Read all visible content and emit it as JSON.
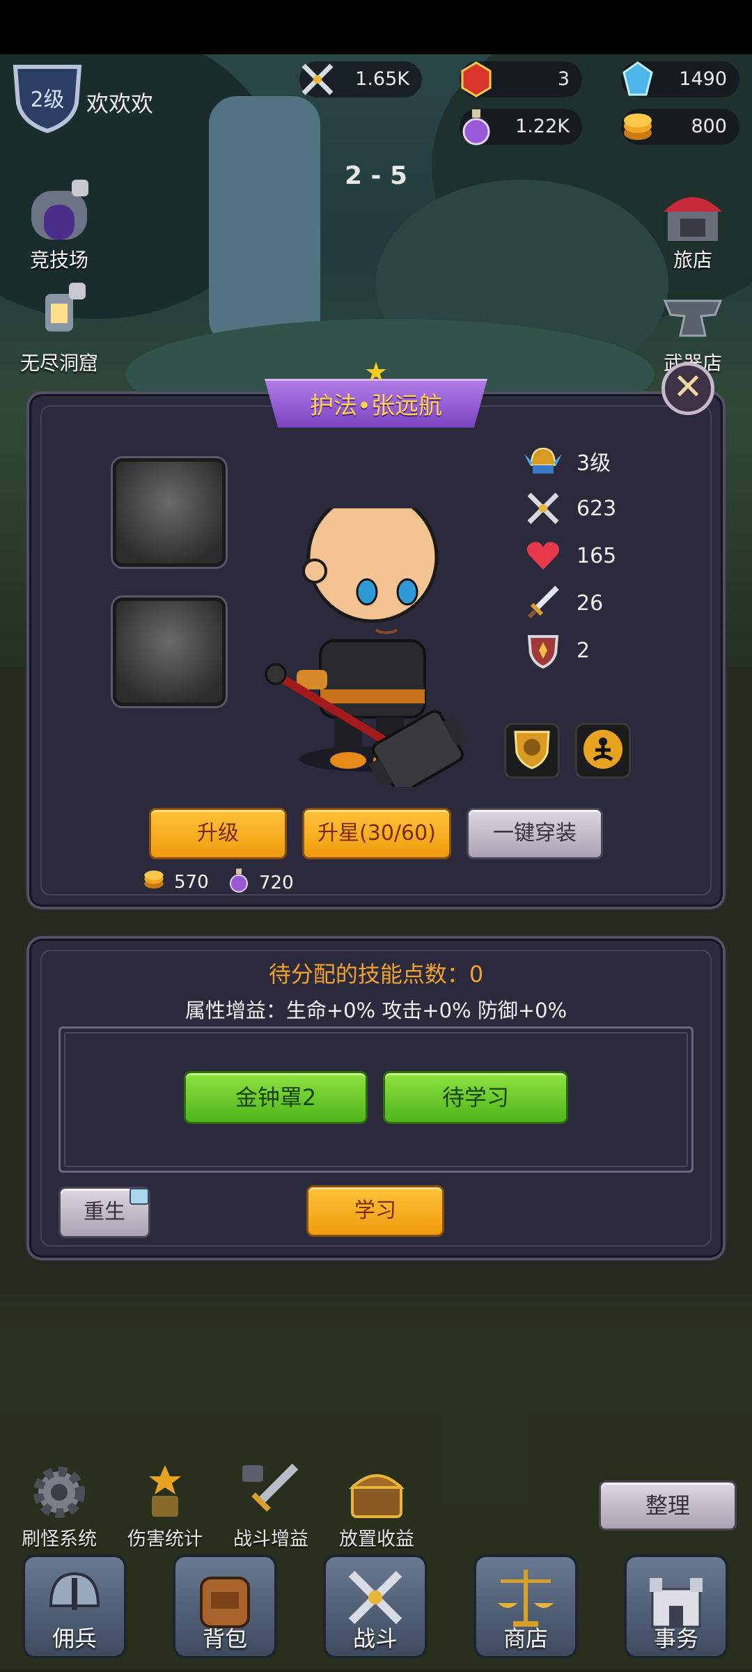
{
  "hud": {
    "level": "2级",
    "player_name": "欢欢欢",
    "power": "1.65K",
    "gems_red": "3",
    "gems_blue": "1490",
    "potion": "1.22K",
    "coins": "800",
    "stage": "2 - 5"
  },
  "side_left": [
    {
      "label": "竞技场",
      "icon": "arena-gate-icon"
    },
    {
      "label": "无尽洞窟",
      "icon": "cave-lantern-icon"
    }
  ],
  "side_right": [
    {
      "label": "旅店",
      "icon": "inn-icon"
    },
    {
      "label": "武器店",
      "icon": "anvil-icon"
    }
  ],
  "hero_panel": {
    "title": "护法•张远航",
    "stars": 1,
    "stats": {
      "level": "3级",
      "power": "623",
      "hp": "165",
      "attack": "26",
      "defense": "2"
    },
    "buttons": {
      "upgrade": "升级",
      "star_up": "升星(30/60)",
      "equip_all": "一键穿装"
    },
    "costs": {
      "coins": "570",
      "potion": "720"
    }
  },
  "skill_panel": {
    "points_label": "待分配的技能点数：0",
    "bonus_label": "属性增益：生命+0% 攻击+0% 防御+0%",
    "skills": [
      "金钟罩2",
      "待学习"
    ],
    "rebirth": "重生",
    "learn": "学习"
  },
  "bottom_options": [
    "刷怪系统",
    "伤害统计",
    "战斗增益",
    "放置收益"
  ],
  "organize": "整理",
  "nav": [
    "佣兵",
    "背包",
    "战斗",
    "商店",
    "事务"
  ],
  "colors": {
    "gold_button": "#f5a91c",
    "green_button": "#6dcc2a",
    "panel_bg": "#2a2a3c",
    "title_gold": "#ffd44a",
    "ribbon_purple": "#9a5fd8"
  }
}
